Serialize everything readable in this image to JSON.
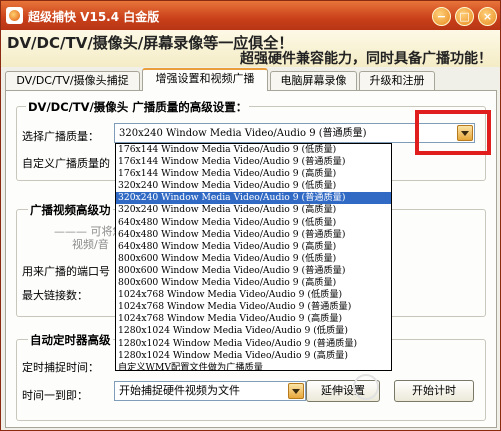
{
  "window": {
    "title": "超级捕快 V15.4 白金版",
    "minimize_glyph": "−",
    "maximize_glyph": "□",
    "close_glyph": "×"
  },
  "banner": {
    "line1": "DV/DC/TV/摄像头/屏幕录像等一应俱全！",
    "line2": "超强硬件兼容能力，同时具备广播功能！"
  },
  "tabs": [
    {
      "label": "DV/DC/TV/摄像头捕捉"
    },
    {
      "label": "增强设置和视频广播"
    },
    {
      "label": "电脑屏幕录像"
    },
    {
      "label": "升级和注册"
    }
  ],
  "broadcast_quality": {
    "title": "DV/DC/TV/摄像头 广播质量的高级设置：",
    "select_label": "选择广播质量：",
    "selected_value": "320x240 Window Media Video/Audio 9 (普通质量)",
    "custom_label": "自定义广播质量的"
  },
  "dropdown_options": [
    "176x144 Window Media Video/Audio 9 (低质量)",
    "176x144 Window Media Video/Audio 9 (普通质量)",
    "176x144 Window Media Video/Audio 9 (高质量)",
    "320x240 Window Media Video/Audio 9 (低质量)",
    "320x240 Window Media Video/Audio 9 (普通质量)",
    "320x240 Window Media Video/Audio 9 (高质量)",
    "640x480 Window Media Video/Audio 9 (低质量)",
    "640x480 Window Media Video/Audio 9 (普通质量)",
    "640x480 Window Media Video/Audio 9 (高质量)",
    "800x600 Window Media Video/Audio 9 (低质量)",
    "800x600 Window Media Video/Audio 9 (普通质量)",
    "800x600 Window Media Video/Audio 9 (高质量)",
    "1024x768 Window Media Video/Audio 9 (低质量)",
    "1024x768 Window Media Video/Audio 9 (普通质量)",
    "1024x768 Window Media Video/Audio 9 (高质量)",
    "1280x1024 Window Media Video/Audio 9 (低质量)",
    "1280x1024 Window Media Video/Audio 9 (普通质量)",
    "1280x1024 Window Media Video/Audio 9 (高质量)",
    "自定义WMV配置文件做为广播质量"
  ],
  "selected_option_index": 4,
  "broadcast_video": {
    "title": "广播视频高级功",
    "hint1": "可将您",
    "hint2": "视频/音",
    "port_label": "用来广播的端口号",
    "max_conn_label": "最大链接数："
  },
  "timed_capture": {
    "title": "自动定时器高级",
    "start_time_label": "定时捕捉时间：",
    "time_arrives_label": "时间一到即：",
    "action_value": "开始捕捉硬件视频为文件",
    "delay_button": "延伸设置",
    "start_timer_button": "开始计时"
  },
  "colors": {
    "title_bar": "#c9401a",
    "selection": "#316ac5",
    "annotation_box": "#e01e1e"
  }
}
